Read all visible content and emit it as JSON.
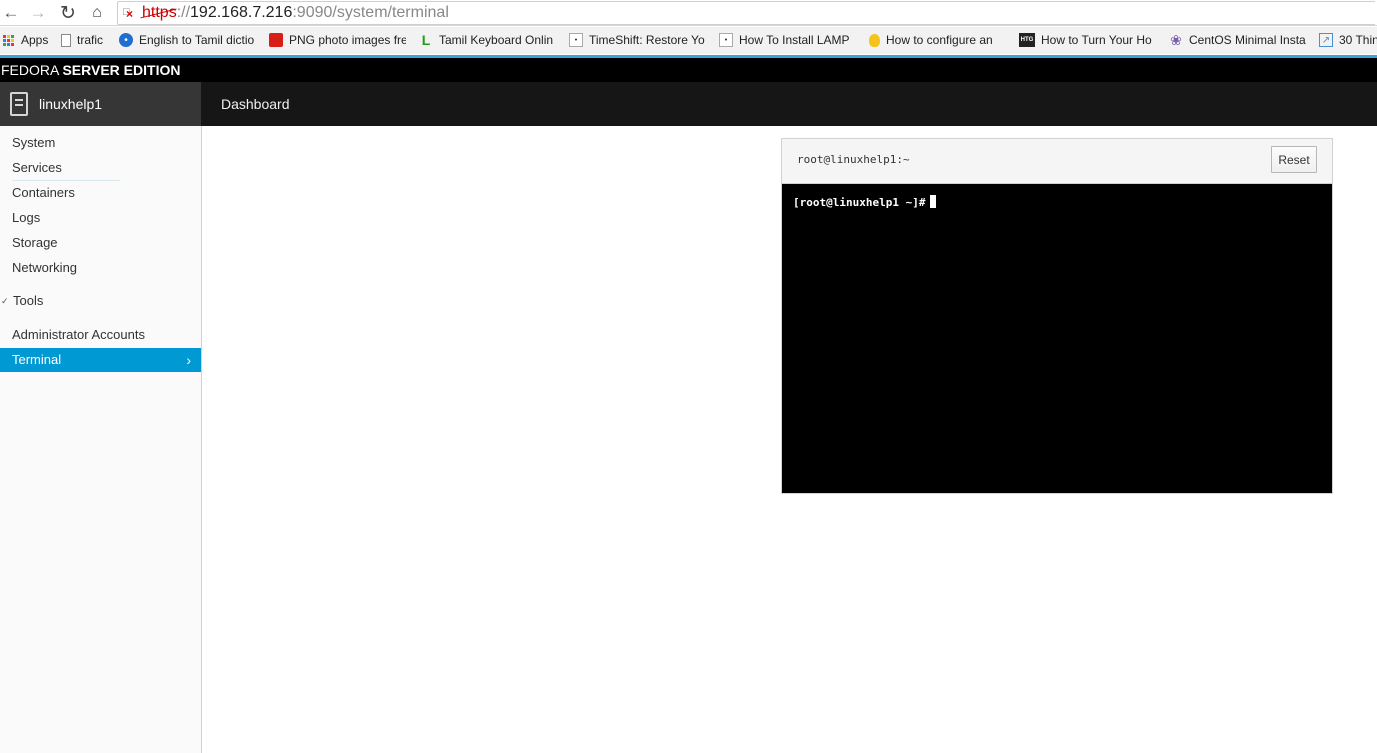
{
  "browser": {
    "url_scheme": "https",
    "url_sep": "://",
    "url_host": "192.168.7.216",
    "url_rest": ":9090/system/terminal",
    "bookmarks": [
      {
        "label": "Apps",
        "icon": "apps-grid-icon"
      },
      {
        "label": "trafic",
        "icon": "page-icon"
      },
      {
        "label": "English to Tamil dictio",
        "icon": "blue-circle-icon"
      },
      {
        "label": "PNG photo images fre",
        "icon": "red-square-icon"
      },
      {
        "label": "Tamil Keyboard Onlin",
        "icon": "green-l-icon"
      },
      {
        "label": "TimeShift: Restore Yo",
        "icon": "site-icon"
      },
      {
        "label": "How To Install LAMP",
        "icon": "site-icon"
      },
      {
        "label": "How to configure an",
        "icon": "bulb-icon"
      },
      {
        "label": "How to Turn Your Ho",
        "icon": "htg-icon"
      },
      {
        "label": "CentOS Minimal Insta",
        "icon": "gear-icon"
      },
      {
        "label": "30 Thin",
        "icon": "chart-icon"
      }
    ],
    "htg_text": "HTG"
  },
  "brand": {
    "light": "FEDORA ",
    "bold": "SERVER EDITION"
  },
  "navbar": {
    "host": "linuxhelp1",
    "dashboard": "Dashboard"
  },
  "sidebar": {
    "items": [
      "System",
      "Services",
      "Containers",
      "Logs",
      "Storage",
      "Networking"
    ],
    "tools_label": "Tools",
    "tools_items": [
      "Administrator Accounts",
      "Terminal"
    ]
  },
  "terminal": {
    "title": "root@linuxhelp1:~",
    "reset_label": "Reset",
    "prompt": "[root@linuxhelp1 ~]#"
  },
  "colors": {
    "accent": "#0099d3",
    "chrome_blue": "#39a5dc"
  }
}
